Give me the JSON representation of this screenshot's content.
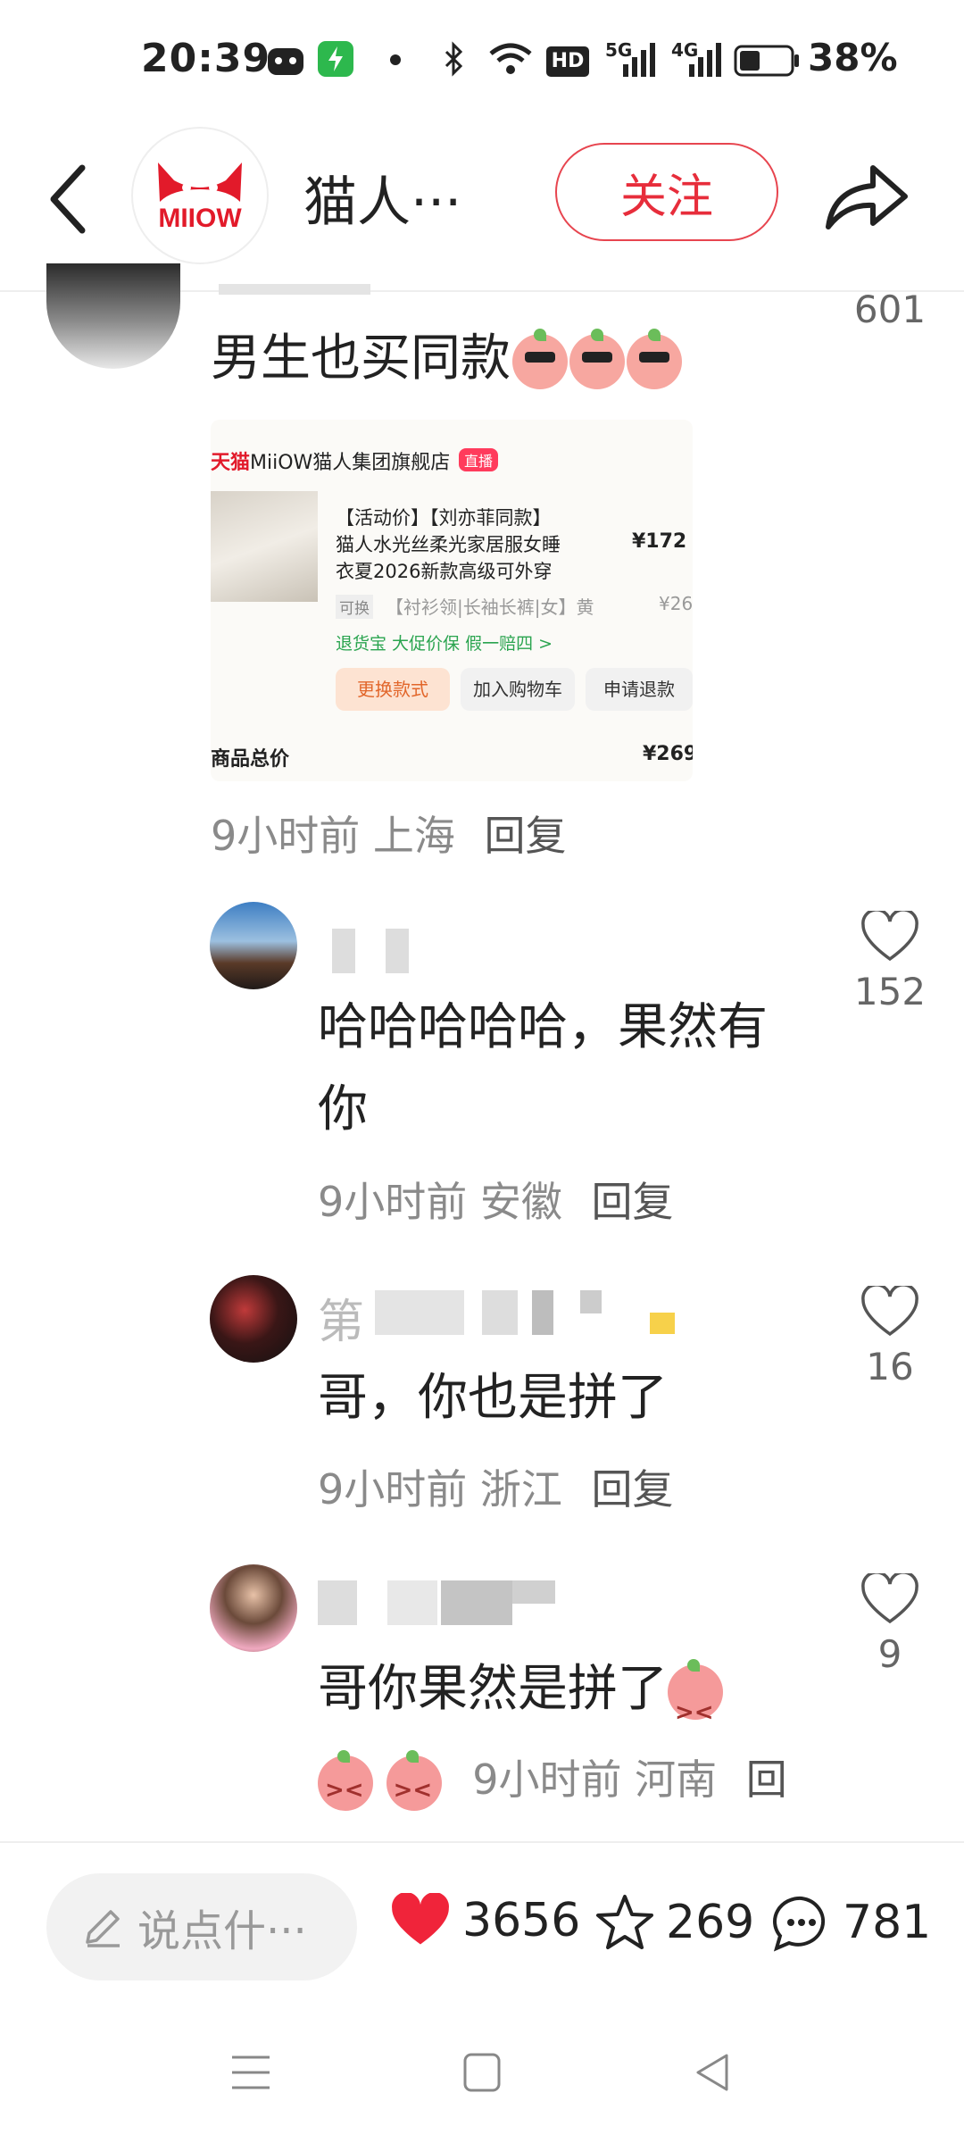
{
  "status": {
    "time": "20:39",
    "hd": "HD",
    "net1": "5G",
    "net2": "4G",
    "battery": "38%"
  },
  "header": {
    "shop_name": "猫人···",
    "logo_text": "MIIOW",
    "follow_label": "关注"
  },
  "comments": [
    {
      "text": "男生也买同款",
      "likes": "601",
      "meta_time": "9小时前",
      "meta_loc": "上海",
      "reply": "回复"
    },
    {
      "text": "哈哈哈哈哈，果然有你",
      "line1": "哈哈哈哈哈，果然有",
      "line2": "你",
      "likes": "152",
      "meta_time": "9小时前",
      "meta_loc": "安徽",
      "reply": "回复"
    },
    {
      "name_prefix": "第",
      "text": "哥，你也是拼了",
      "likes": "16",
      "meta_time": "9小时前",
      "meta_loc": "浙江",
      "reply": "回复"
    },
    {
      "text": "哥你果然是拼了",
      "likes": "9",
      "meta_time": "9小时前",
      "meta_loc": "河南",
      "reply": "回"
    }
  ],
  "card": {
    "platform": "天猫",
    "store": "MiiOW猫人集团旗舰店",
    "live": "直播",
    "title_line1": "【活动价】【刘亦菲同款】",
    "title_line2": "猫人水光丝柔光家居服女睡",
    "title_line3": "衣夏2026新款高级可外穿",
    "price": "¥172",
    "option_tag": "可换",
    "option": "【衬衫领|长袖长裤|女】黄",
    "option_price": "¥26",
    "services": "退货宝  大促价保  假一赔四 >",
    "btn_change": "更换款式",
    "btn_cart": "加入购物车",
    "btn_refund": "申请退款",
    "total_label": "商品总价",
    "total_price": "¥269"
  },
  "bottom": {
    "input_placeholder": "说点什···",
    "likes": "3656",
    "favorites": "269",
    "comments": "781"
  },
  "colors": {
    "accent": "#e72d3b",
    "text": "#222222",
    "meta": "#8a8a8a"
  }
}
